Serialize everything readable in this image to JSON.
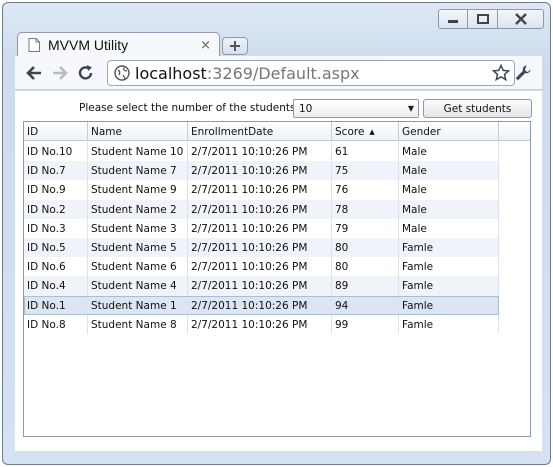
{
  "browser": {
    "tab_title": "MVVM Utility",
    "tab_close_glyph": "×",
    "url_host": "localhost",
    "url_rest": ":3269/Default.aspx",
    "icons": [
      "page-icon",
      "new-tab-icon",
      "back-arrow-icon",
      "forward-arrow-icon",
      "reload-icon",
      "globe-icon",
      "star-icon",
      "wrench-icon",
      "minimize-icon",
      "maximize-icon",
      "close-icon"
    ]
  },
  "selector": {
    "label": "Please select the number of the students",
    "value": "10",
    "button_label": "Get students"
  },
  "grid": {
    "columns": [
      "ID",
      "Name",
      "EnrollmentDate",
      "Score",
      "Gender"
    ],
    "sorted_column": "Score",
    "sort_direction": "ascending",
    "rows": [
      [
        "ID No.10",
        "Student Name 10",
        "2/7/2011 10:10:26 PM",
        "61",
        "Male"
      ],
      [
        "ID No.7",
        "Student Name 7",
        "2/7/2011 10:10:26 PM",
        "75",
        "Male"
      ],
      [
        "ID No.9",
        "Student Name 9",
        "2/7/2011 10:10:26 PM",
        "76",
        "Male"
      ],
      [
        "ID No.2",
        "Student Name 2",
        "2/7/2011 10:10:26 PM",
        "78",
        "Male"
      ],
      [
        "ID No.3",
        "Student Name 3",
        "2/7/2011 10:10:26 PM",
        "79",
        "Male"
      ],
      [
        "ID No.5",
        "Student Name 5",
        "2/7/2011 10:10:26 PM",
        "80",
        "Famle"
      ],
      [
        "ID No.6",
        "Student Name 6",
        "2/7/2011 10:10:26 PM",
        "80",
        "Famle"
      ],
      [
        "ID No.4",
        "Student Name 4",
        "2/7/2011 10:10:26 PM",
        "89",
        "Famle"
      ],
      [
        "ID No.1",
        "Student Name 1",
        "2/7/2011 10:10:26 PM",
        "94",
        "Famle"
      ],
      [
        "ID No.8",
        "Student Name 8",
        "2/7/2011 10:10:26 PM",
        "99",
        "Famle"
      ]
    ],
    "selected_row_index": 8
  }
}
